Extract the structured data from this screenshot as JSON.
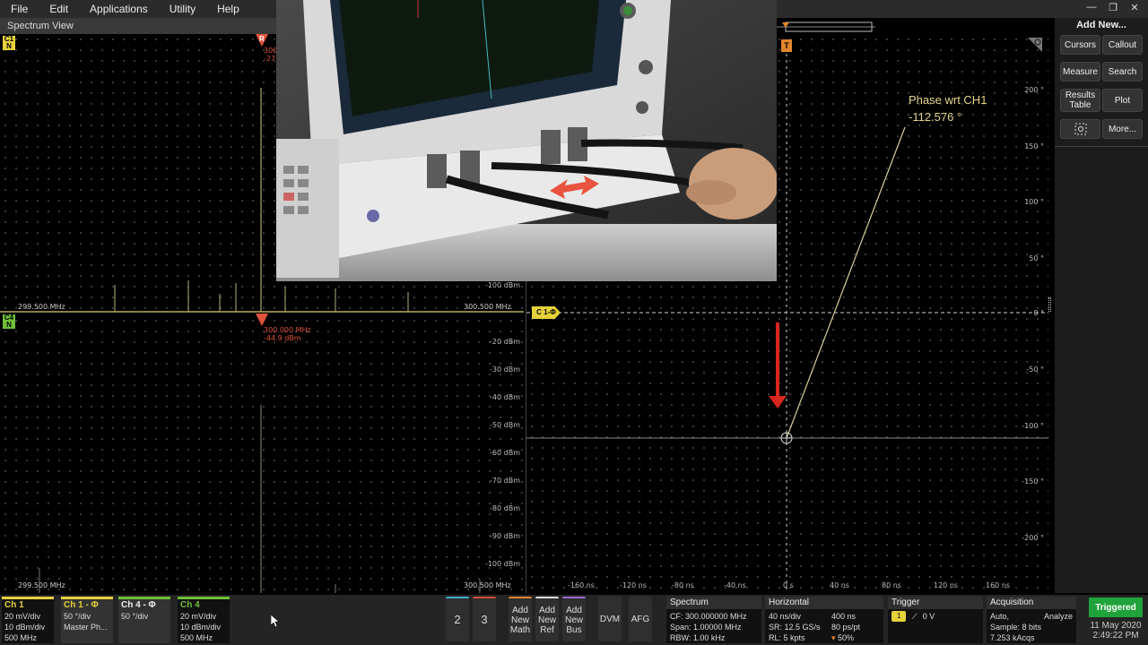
{
  "menu": [
    "File",
    "Edit",
    "Applications",
    "Utility",
    "Help"
  ],
  "spectrum": {
    "title": "Spectrum View",
    "top": {
      "badge_ch": "C1",
      "badge_n": "N",
      "freq_start": "299.500 MHz",
      "freq_end": "300.500 MHz",
      "marker_freq": "300",
      "marker_level": "-27"
    },
    "bottom": {
      "badge_ch": "C4",
      "badge_n": "N",
      "freq_start": "299.500 MHz",
      "freq_end": "300.500 MHz",
      "marker_freq": "300.000 MHz",
      "marker_level": "-44.9 dBm"
    },
    "marker_r": "R",
    "db_labels_top": [
      "-100 dBm"
    ],
    "db_labels_bottom": [
      "-20 dBm",
      "-30 dBm",
      "-40 dBm",
      "-50 dBm",
      "-60 dBm",
      "-70 dBm",
      "-80 dBm",
      "-90 dBm",
      "-100 dBm"
    ]
  },
  "phase": {
    "readout_title": "Phase wrt CH1",
    "readout_value": "-112.576 °",
    "ref_badge": "C 1-Φ",
    "trigger_badge": "T",
    "deg_labels": [
      "200 °",
      "150 °",
      "100 °",
      "50 °",
      "0 °",
      "-50 °",
      "-100 °",
      "-150 °",
      "-200 °"
    ],
    "time_labels": [
      "-160 ns",
      "-120 ns",
      "-80 ns",
      "-40 ns",
      "0 s",
      "40 ns",
      "80 ns",
      "120 ns",
      "160 ns"
    ]
  },
  "sidebar": {
    "title": "Add New...",
    "buttons": [
      "Cursors",
      "Callout",
      "Measure",
      "Search",
      "Results Table",
      "Plot",
      "More..."
    ]
  },
  "channels": [
    {
      "name": "Ch 1",
      "line1": "20 mV/div",
      "line2": "10 dBm/div",
      "line3": "500 MHz",
      "color": "#e6d23a"
    },
    {
      "name": "Ch 1 - Φ",
      "line1": "50 °/div",
      "line2": "Master Ph...",
      "line3": "",
      "color": "#e6d23a"
    },
    {
      "name": "Ch 4 - Φ",
      "line1": "50 °/div",
      "line2": "",
      "line3": "",
      "color": "#6fbf3a"
    },
    {
      "name": "Ch 4",
      "line1": "20 mV/div",
      "line2": "10 dBm/div",
      "line3": "500 MHz",
      "color": "#6fbf3a"
    }
  ],
  "bottom_buttons": {
    "ref2": "2",
    "ref3": "3",
    "add_math": "Add New Math",
    "add_ref": "Add New Ref",
    "add_bus": "Add New Bus",
    "dvm": "DVM",
    "afg": "AFG"
  },
  "spectrum_box": {
    "title": "Spectrum",
    "cf": "CF: 300.000000 MHz",
    "span": "Span: 1.00000 MHz",
    "rbw": "RBW: 1.00 kHz"
  },
  "horizontal_box": {
    "title": "Horizontal",
    "a1": "40 ns/div",
    "a2": "400 ns",
    "b1": "SR: 12.5 GS/s",
    "b2": "80 ps/pt",
    "c1": "RL: 5 kpts",
    "c2": "50%"
  },
  "trigger_box": {
    "title": "Trigger",
    "level": "0 V",
    "source": "1"
  },
  "acquisition_box": {
    "title": "Acquisition",
    "mode": "Auto,",
    "analyze": "Analyze",
    "sample": "Sample: 8 bits",
    "acqs": "7.253 kAcqs"
  },
  "status": {
    "triggered": "Triggered",
    "date": "11 May 2020",
    "time": "2:49:22 PM"
  }
}
